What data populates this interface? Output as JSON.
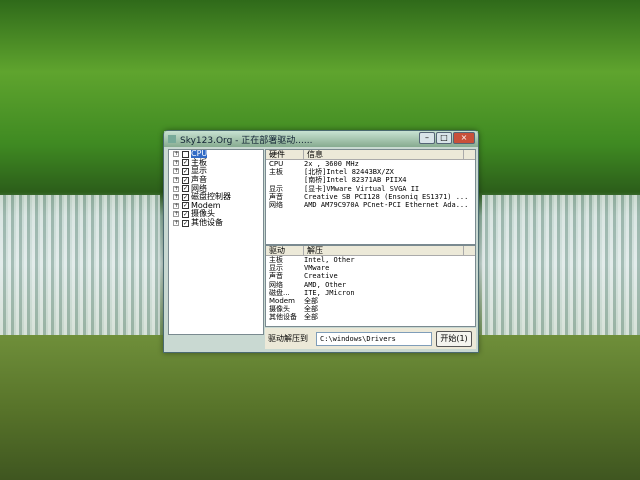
{
  "window": {
    "title": "Sky123.Org - 正在部署驱动......",
    "minimize": "–",
    "maximize": "□",
    "close": "×"
  },
  "tree": [
    {
      "label": "CPU",
      "checked": false,
      "selected": true
    },
    {
      "label": "主板",
      "checked": true
    },
    {
      "label": "显示",
      "checked": true
    },
    {
      "label": "声音",
      "checked": true
    },
    {
      "label": "网络",
      "checked": true
    },
    {
      "label": "磁盘控制器",
      "checked": true
    },
    {
      "label": "Modem",
      "checked": true
    },
    {
      "label": "摄像头",
      "checked": true
    },
    {
      "label": "其他设备",
      "checked": true
    }
  ],
  "hardware": {
    "headers": [
      "硬件",
      "信息"
    ],
    "rows": [
      [
        "CPU",
        "2x , 3600 MHz"
      ],
      [
        "主板",
        "[北桥]Intel 82443BX/ZX"
      ],
      [
        "",
        "[南桥]Intel 82371AB PIIX4"
      ],
      [
        "显示",
        "[显卡]VMware Virtual SVGA II"
      ],
      [
        "声音",
        "Creative SB PCI128 (Ensoniq ES1371) ..."
      ],
      [
        "网络",
        "AMD AM79C970A PCnet-PCI Ethernet Ada..."
      ]
    ]
  },
  "drivers": {
    "headers": [
      "驱动",
      "解压"
    ],
    "rows": [
      [
        "主板",
        "Intel, Other"
      ],
      [
        "显示",
        "VMware"
      ],
      [
        "声音",
        "Creative"
      ],
      [
        "网络",
        "AMD, Other"
      ],
      [
        "磁盘...",
        "ITE, JMicron"
      ],
      [
        "Modem",
        "全部"
      ],
      [
        "摄像头",
        "全部"
      ],
      [
        "其他设备",
        "全部"
      ]
    ]
  },
  "bottom": {
    "label": "驱动解压到",
    "path": "C:\\windows\\Drivers",
    "start": "开始(1)"
  }
}
